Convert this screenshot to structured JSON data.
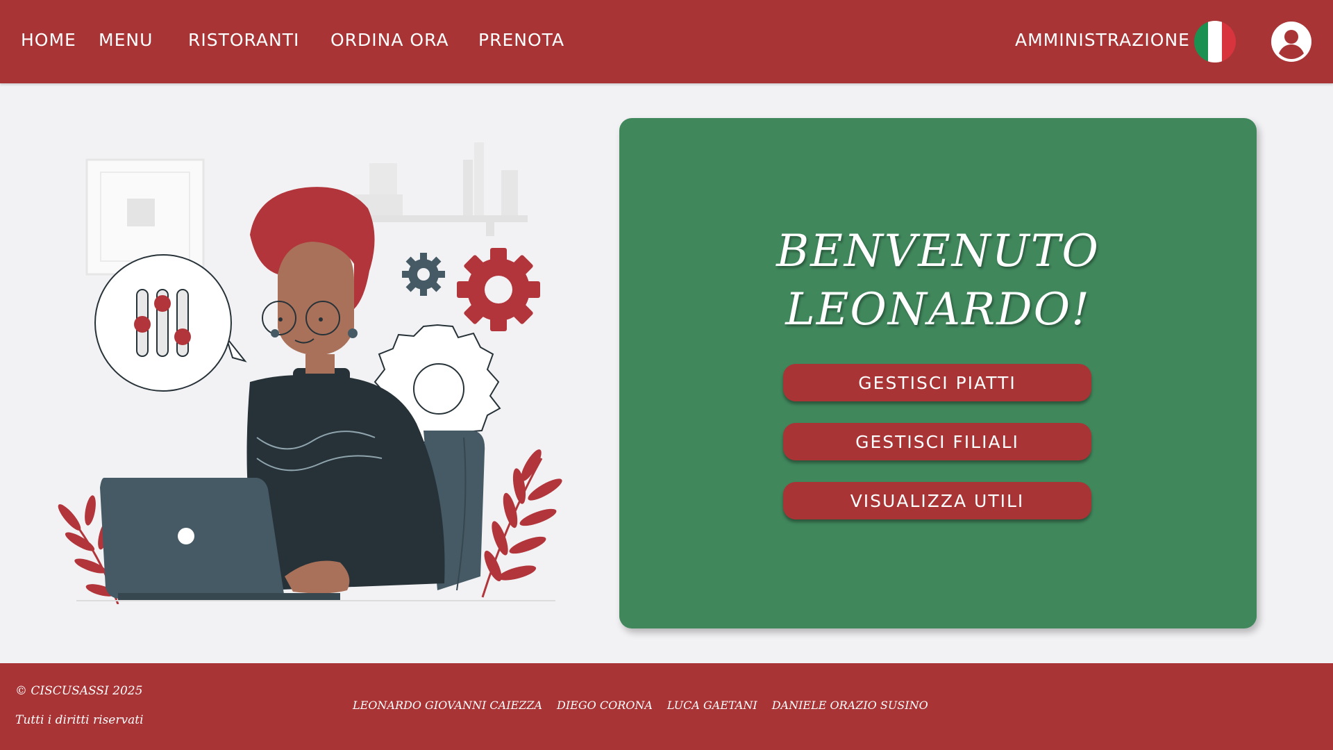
{
  "nav": {
    "items": [
      {
        "label": "HOME"
      },
      {
        "label": "MENU"
      },
      {
        "label": "RISTORANTI"
      },
      {
        "label": "ORDINA ORA"
      },
      {
        "label": "PRENOTA"
      }
    ],
    "admin_label": "AMMINISTRAZIONE",
    "language_icon": "italy-flag-icon",
    "account_icon": "user-circle-icon"
  },
  "welcome": {
    "line1": "BENVENUTO",
    "line2": "LEONARDO!"
  },
  "actions": {
    "manage_dishes": "GESTISCI PIATTI",
    "manage_branches": "GESTISCI FILIALI",
    "view_profits": "VISUALIZZA UTILI"
  },
  "footer": {
    "copyright": "© CISCUSASSI 2025",
    "rights": "Tutti i diritti riservati",
    "authors": [
      "LEONARDO GIOVANNI CAIEZZA",
      "DIEGO CORONA",
      "LUCA GAETANI",
      "DANIELE ORAZIO SUSINO"
    ]
  },
  "colors": {
    "brand_red": "#a83436",
    "card_green": "#40875c",
    "background": "#f2f2f4"
  }
}
